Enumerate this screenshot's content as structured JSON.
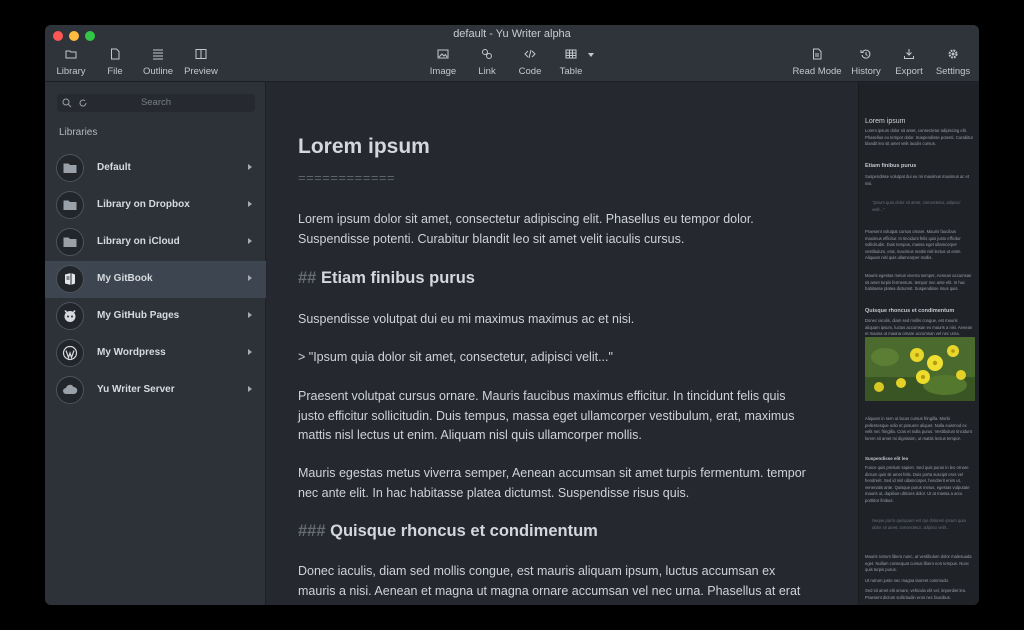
{
  "window": {
    "title": "default - Yu Writer alpha"
  },
  "toolbar": {
    "library": "Library",
    "file": "File",
    "outline": "Outline",
    "preview": "Preview",
    "image": "Image",
    "link": "Link",
    "code": "Code",
    "table": "Table",
    "read_mode": "Read Mode",
    "history": "History",
    "export": "Export",
    "settings": "Settings"
  },
  "sidebar": {
    "search_placeholder": "Search",
    "heading": "Libraries",
    "items": [
      {
        "label": "Default",
        "icon": "folder-icon"
      },
      {
        "label": "Library on Dropbox",
        "icon": "folder-icon"
      },
      {
        "label": "Library on iCloud",
        "icon": "folder-icon"
      },
      {
        "label": "My GitBook",
        "icon": "gitbook-icon",
        "active": true
      },
      {
        "label": "My GitHub Pages",
        "icon": "github-icon"
      },
      {
        "label": "My Wordpress",
        "icon": "wordpress-icon"
      },
      {
        "label": "Yu Writer Server",
        "icon": "cloud-icon"
      }
    ]
  },
  "editor": {
    "h1": "Lorem ipsum",
    "h1_underline": "============",
    "p1_line1": "Lorem ipsum dolor sit amet, consectetur adipiscing elit. Phasellus eu tempor dolor.",
    "p1_line2": "Suspendisse potenti. Curabitur blandit leo sit amet velit iaculis cursus.",
    "h2_marker": "##",
    "h2_text": "Etiam finibus purus",
    "p2": "Suspendisse volutpat dui eu mi maximus maximus ac et nisi.",
    "quote": "> \"Ipsum quia dolor sit amet, consectetur, adipisci velit...\"",
    "p3_line1": "Praesent volutpat cursus ornare. Mauris faucibus maximus efficitur. In tincidunt felis quis",
    "p3_line2": "justo efficitur sollicitudin. Duis tempus, massa eget ullamcorper vestibulum, erat, maximus",
    "p3_line3": "mattis nisl lectus ut enim. Aliquam nisl quis ullamcorper mollis.",
    "p4_line1": "Mauris egestas metus viverra semper, Aenean accumsan sit amet turpis fermentum. tempor",
    "p4_line2": "nec ante elit. In hac habitasse platea dictumst. Suspendisse risus quis.",
    "h3_marker": "###",
    "h3_text": "Quisque rhoncus et condimentum",
    "p5_line1": "Donec iaculis, diam sed mollis congue, est mauris aliquam ipsum, luctus accumsan ex",
    "p5_line2": "mauris a nisi. Aenean et magna ut magna ornare accumsan vel nec urna. Phasellus at erat"
  },
  "preview": {
    "h1": "Lorem ipsum",
    "t1": "Lorem ipsum dolor sit amet, consectetur adipiscing elit. Phasellus eu tempor dolor. Suspendisse potenti. Curabitur blandit leo sit amet velit iaculis cursus.",
    "h2": "Etiam finibus purus",
    "t2": "Suspendisse volutpat dui eu mi maximus maximus ac et nisi.",
    "q1": "\"Ipsum quia dolor sit amet, consectetur, adipisci velit...\"",
    "t3": "Praesent volutpat cursus ornare. Mauris faucibus maximus efficitur. In tincidunt felis quis justo efficitur sollicitudin. Duis tempus, massa eget ullamcorper vestibulum, erat, maximus mattis nisl lectus ut enim. Aliquam nisl quis ullamcorper mollis.",
    "t4": "Mauris egestas metus viverra semper, Aenean accumsan sit amet turpis fermentum. tempor nec ante elit. In hac habitasse platea dictumst. Suspendisse risus quis.",
    "h3": "Quisque rhoncus et condimentum",
    "t5": "Donec iaculis, diam sed mollis congue, est mauris aliquam ipsum, luctus accumsan ex mauris a nisi. Aenean et magna ut magna ornare accumsan vel nec urna. Phasellus at erat ut risus aliquam lobortis.",
    "t6": "Aliquam in sem ut lacus cursus fringilla. Morbi pellentesque odio et posuere aliquet. Nulla euismod ex velit nec fringilla. Cras et nulla purus. Vestibulum tincidunt lorem sit amet mi dignissim, ut mattis lectus tempor.",
    "h4": "Suspendisse elit leo",
    "t7": "Fusce quis pretium sapien. Sed quis purus in leo ornare dictum quis sit amet felis. Duis porta suscipit eros vel hendrerit. Sed id nisl ullamcorper, hendrerit enim ut, venenatis ante. Quisque purus metus, egestas vulputate mauris ut, dapibus ultricies dolor. Ut at massa a arcu porttitor finibus.",
    "q2": "Neque porro quisquam est qui dolorem ipsum quia dolor sit amet, consectetur, adipisci velit...",
    "t8": "Mauris rutrum libero nunc, at vestibulum dolor malesuada eget. Nullam consequat cursus libero non tempus. Nunc quis turpis purus.",
    "t9": "Ut rutrum justo nec magna laoreet commodo.",
    "t10": "Sed sit amet elit ornare, vehicula elit vel, imperdiet leo. Praesent dictum sollicitudin eros nec faucibus."
  },
  "colors": {
    "accent_active": "#3d4650",
    "background": "#25292f",
    "sidebar": "#2d3238"
  }
}
